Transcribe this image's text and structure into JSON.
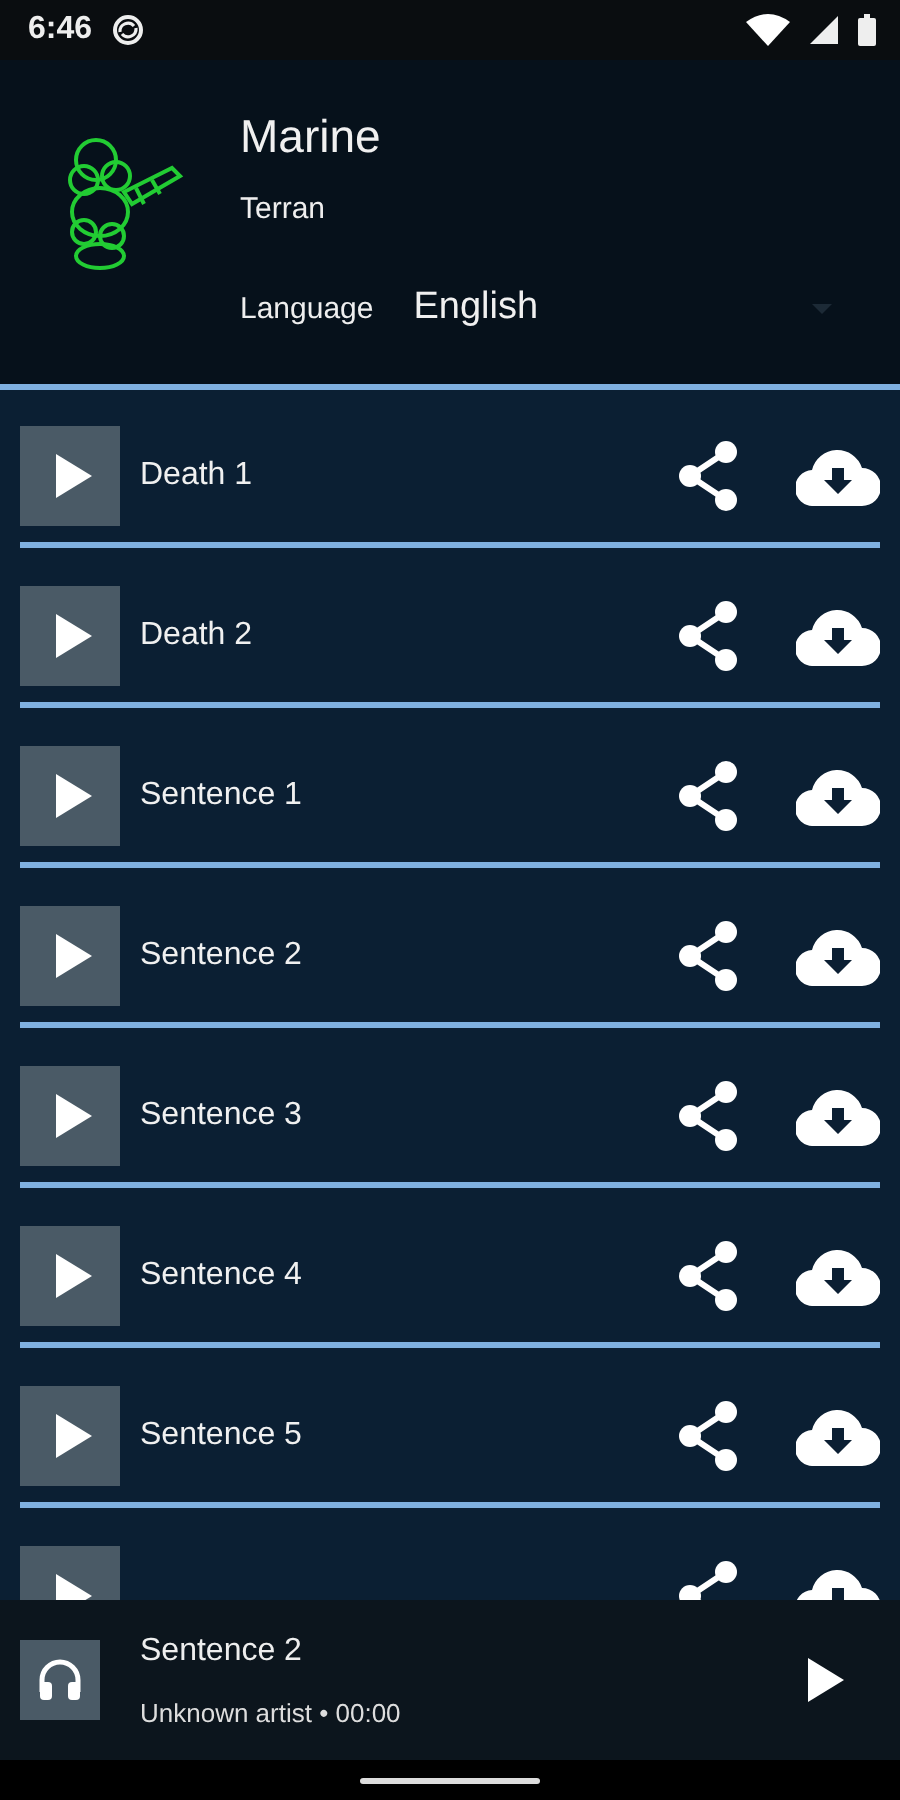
{
  "status_bar": {
    "time": "6:46"
  },
  "unit": {
    "name": "Marine",
    "race": "Terran"
  },
  "language": {
    "label": "Language",
    "value": "English"
  },
  "sounds": [
    {
      "kind": "full",
      "title": "Death 1"
    },
    {
      "kind": "full",
      "title": "Death 2"
    },
    {
      "kind": "full",
      "title": "Sentence 1"
    },
    {
      "kind": "full",
      "title": "Sentence 2"
    },
    {
      "kind": "full",
      "title": "Sentence 3"
    },
    {
      "kind": "full",
      "title": "Sentence 4"
    },
    {
      "kind": "full",
      "title": "Sentence 5"
    },
    {
      "kind": "covered"
    }
  ],
  "player": {
    "title": "Sentence 2",
    "subtitle": "Unknown artist • 00:00"
  }
}
